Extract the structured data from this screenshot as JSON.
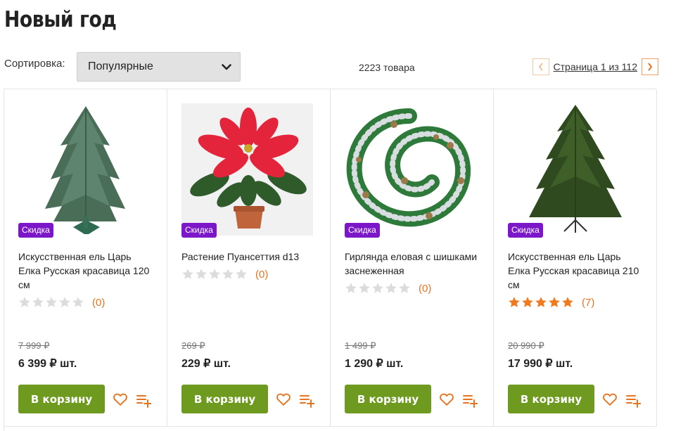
{
  "page": {
    "title": "Новый год"
  },
  "toolbar": {
    "sort_label": "Сортировка:",
    "sort_value": "Популярные",
    "count": "2223 товара",
    "pagination": "Страница 1 из 112",
    "prev_icon": "chevron-left-icon",
    "next_icon": "chevron-right-icon"
  },
  "colors": {
    "accent": "#e8731f",
    "badge": "#7b17c9",
    "cart_button": "#6e9a1f",
    "star_filled": "#f07a1e",
    "star_empty": "#dcdcdc"
  },
  "products": [
    {
      "image": "artificial-fir-tree-image",
      "badge": "Скидка",
      "title": "Искусственная ель Царь Елка Русская красавица 120 см",
      "stars": 0,
      "reviews": "(0)",
      "old_price": "7 999 ₽",
      "price": "6 399 ₽ шт.",
      "cart_label": "В корзину"
    },
    {
      "image": "poinsettia-plant-image",
      "badge": "Скидка",
      "title": "Растение Пуансеттия d13",
      "stars": 0,
      "reviews": "(0)",
      "old_price": "269 ₽",
      "price": "229 ₽ шт.",
      "cart_label": "В корзину"
    },
    {
      "image": "snowy-garland-image",
      "badge": "Скидка",
      "title": "Гирлянда еловая с шишками заснеженная",
      "stars": 0,
      "reviews": "(0)",
      "old_price": "1 499 ₽",
      "price": "1 290 ₽ шт.",
      "cart_label": "В корзину"
    },
    {
      "image": "artificial-fir-tree-large-image",
      "badge": "Скидка",
      "title": "Искусственная ель Царь Елка Русская красавица 210 см",
      "stars": 5,
      "reviews": "(7)",
      "old_price": "20 990 ₽",
      "price": "17 990 ₽ шт.",
      "cart_label": "В корзину"
    }
  ]
}
